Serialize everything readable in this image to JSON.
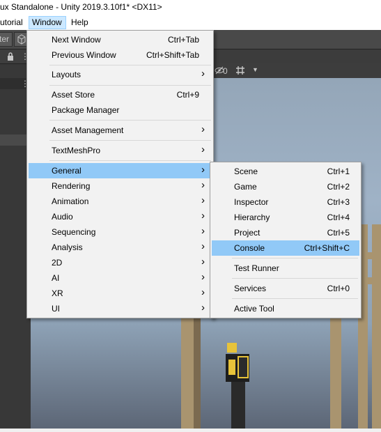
{
  "title": "ux Standalone - Unity 2019.3.10f1* <DX11>",
  "menubar": [
    "utorial",
    "Window",
    "Help"
  ],
  "toolbar": {
    "left_tab": "ter",
    "gizmo_count": "0"
  },
  "window_menu": [
    {
      "label": "Next Window",
      "shortcut": "Ctrl+Tab"
    },
    {
      "label": "Previous Window",
      "shortcut": "Ctrl+Shift+Tab"
    },
    {
      "label": "Layouts",
      "submenu": true
    },
    {
      "label": "Asset Store",
      "shortcut": "Ctrl+9"
    },
    {
      "label": "Package Manager"
    },
    {
      "label": "Asset Management",
      "submenu": true
    },
    {
      "label": "TextMeshPro",
      "submenu": true
    },
    {
      "label": "General",
      "submenu": true,
      "highlighted": true
    },
    {
      "label": "Rendering",
      "submenu": true
    },
    {
      "label": "Animation",
      "submenu": true
    },
    {
      "label": "Audio",
      "submenu": true
    },
    {
      "label": "Sequencing",
      "submenu": true
    },
    {
      "label": "Analysis",
      "submenu": true
    },
    {
      "label": "2D",
      "submenu": true
    },
    {
      "label": "AI",
      "submenu": true
    },
    {
      "label": "XR",
      "submenu": true
    },
    {
      "label": "UI",
      "submenu": true
    }
  ],
  "general_menu": [
    {
      "label": "Scene",
      "shortcut": "Ctrl+1"
    },
    {
      "label": "Game",
      "shortcut": "Ctrl+2"
    },
    {
      "label": "Inspector",
      "shortcut": "Ctrl+3"
    },
    {
      "label": "Hierarchy",
      "shortcut": "Ctrl+4"
    },
    {
      "label": "Project",
      "shortcut": "Ctrl+5"
    },
    {
      "label": "Console",
      "shortcut": "Ctrl+Shift+C",
      "highlighted": true
    },
    {
      "label": "Test Runner"
    },
    {
      "label": "Services",
      "shortcut": "Ctrl+0"
    },
    {
      "label": "Active Tool"
    }
  ],
  "colors": {
    "highlight": "#91c9f7",
    "menu_bg": "#f2f2f2",
    "editor_bg": "#3c3c3c"
  },
  "icons": {
    "submenu": "chevron-right-icon",
    "lock": "lock-icon",
    "more": "kebab-menu-icon",
    "gizmo_visibility": "eye-slash-icon",
    "grid": "grid-icon",
    "dropdown": "caret-down-icon"
  }
}
